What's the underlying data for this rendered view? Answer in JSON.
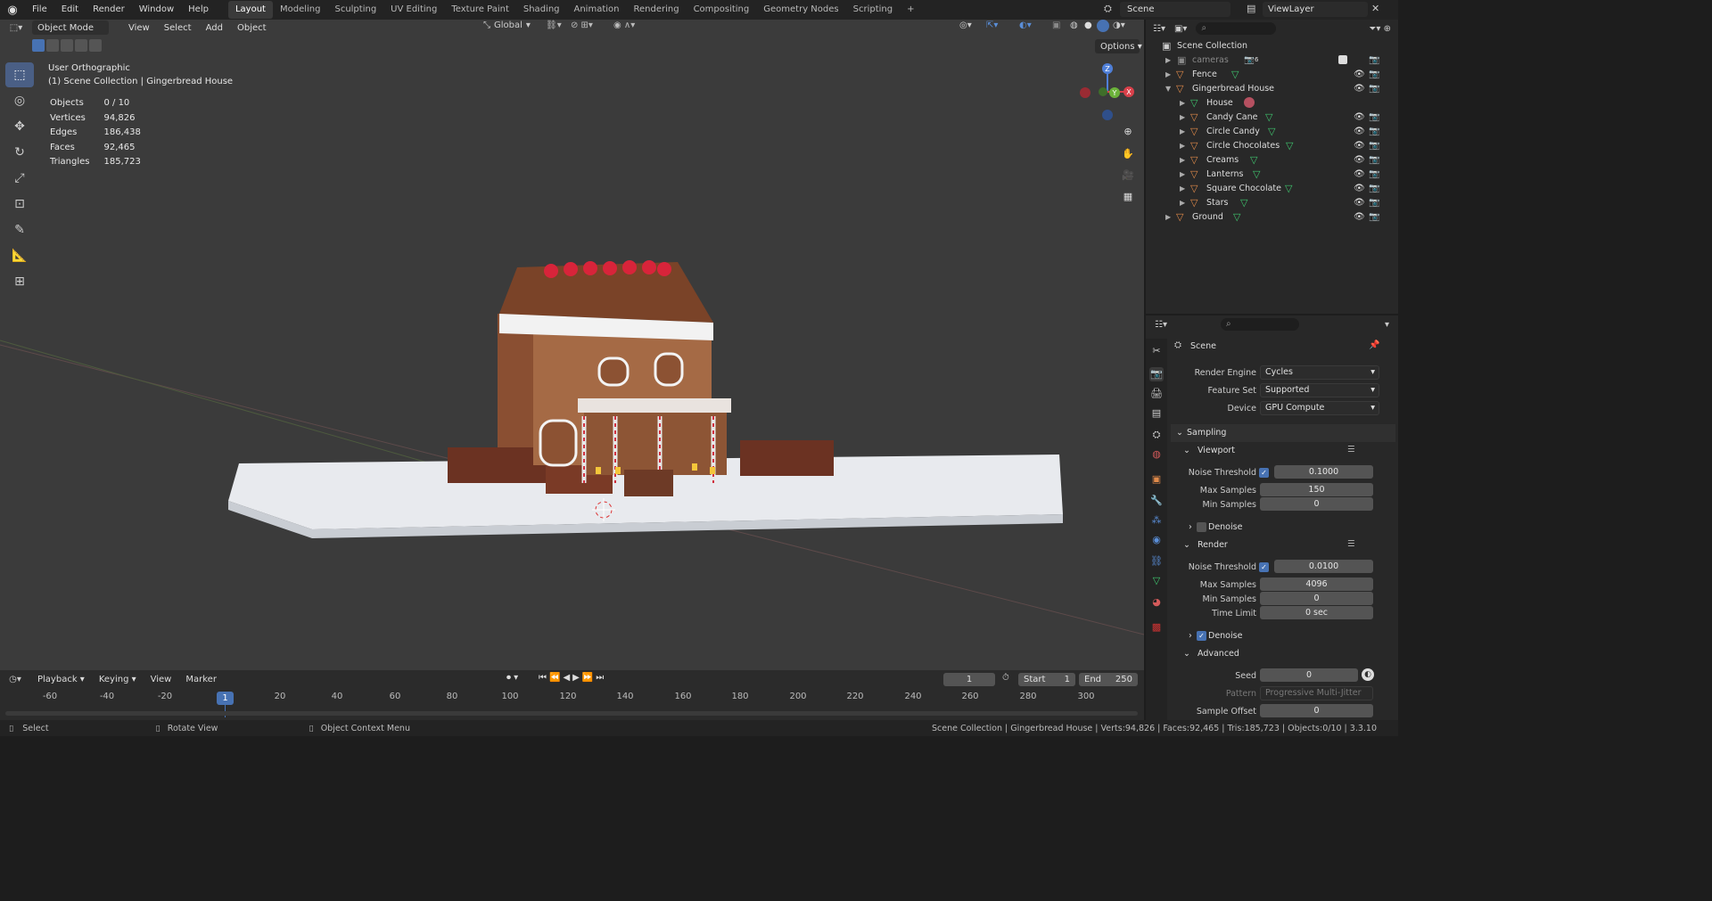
{
  "topbar": {
    "menus": [
      "File",
      "Edit",
      "Render",
      "Window",
      "Help"
    ],
    "workspaces": [
      "Layout",
      "Modeling",
      "Sculpting",
      "UV Editing",
      "Texture Paint",
      "Shading",
      "Animation",
      "Rendering",
      "Compositing",
      "Geometry Nodes",
      "Scripting"
    ],
    "active_workspace": "Layout",
    "add_tab": "+",
    "scene": "Scene",
    "view_layer": "ViewLayer"
  },
  "viewport": {
    "mode": "Object Mode",
    "menus": [
      "View",
      "Select",
      "Add",
      "Object"
    ],
    "transform_orientation": "Global",
    "options": "Options",
    "view_name": "User Orthographic",
    "collection_path": "(1) Scene Collection | Gingerbread House",
    "stats": [
      {
        "label": "Objects",
        "value": "0 / 10"
      },
      {
        "label": "Vertices",
        "value": "94,826"
      },
      {
        "label": "Edges",
        "value": "186,438"
      },
      {
        "label": "Faces",
        "value": "92,465"
      },
      {
        "label": "Triangles",
        "value": "185,723"
      }
    ],
    "gizmo": {
      "z": "Z",
      "y": "Y",
      "x": "X"
    }
  },
  "timeline": {
    "menus": [
      "Playback",
      "Keying",
      "View",
      "Marker"
    ],
    "current_frame": "1",
    "start_label": "Start",
    "start": "1",
    "end_label": "End",
    "end": "250",
    "ticks": [
      "-60",
      "-40",
      "-20",
      "1",
      "20",
      "40",
      "60",
      "80",
      "100",
      "120",
      "140",
      "160",
      "180",
      "200",
      "220",
      "240",
      "260",
      "280",
      "300"
    ]
  },
  "statusbar": {
    "select": "Select",
    "rotate": "Rotate View",
    "context": "Object Context Menu",
    "info": "Scene Collection | Gingerbread House | Verts:94,826 | Faces:92,465 | Tris:185,723 | Objects:0/10 | 3.3.10"
  },
  "outliner": {
    "root": "Scene Collection",
    "items": [
      {
        "name": "cameras",
        "badge": "6"
      },
      {
        "name": "Fence"
      },
      {
        "name": "Gingerbread House"
      },
      {
        "name": "House"
      },
      {
        "name": "Candy Cane"
      },
      {
        "name": "Circle Candy"
      },
      {
        "name": "Circle Chocolates"
      },
      {
        "name": "Creams"
      },
      {
        "name": "Lanterns"
      },
      {
        "name": "Square Chocolate"
      },
      {
        "name": "Stars"
      },
      {
        "name": "Ground"
      }
    ]
  },
  "properties": {
    "context": "Scene",
    "render_engine_label": "Render Engine",
    "render_engine": "Cycles",
    "feature_set_label": "Feature Set",
    "feature_set": "Supported",
    "device_label": "Device",
    "device": "GPU Compute",
    "sampling": "Sampling",
    "viewport_section": "Viewport",
    "noise_threshold_label": "Noise Threshold",
    "viewport_noise_threshold": "0.1000",
    "max_samples_label": "Max Samples",
    "viewport_max_samples": "150",
    "min_samples_label": "Min Samples",
    "viewport_min_samples": "0",
    "denoise_label": "Denoise",
    "render_section": "Render",
    "render_noise_threshold": "0.0100",
    "render_max_samples": "4096",
    "render_min_samples": "0",
    "time_limit_label": "Time Limit",
    "time_limit": "0 sec",
    "advanced": "Advanced",
    "seed_label": "Seed",
    "seed": "0",
    "pattern_label": "Pattern",
    "pattern": "Progressive Multi-Jitter",
    "sample_offset_label": "Sample Offset",
    "sample_offset": "0"
  }
}
